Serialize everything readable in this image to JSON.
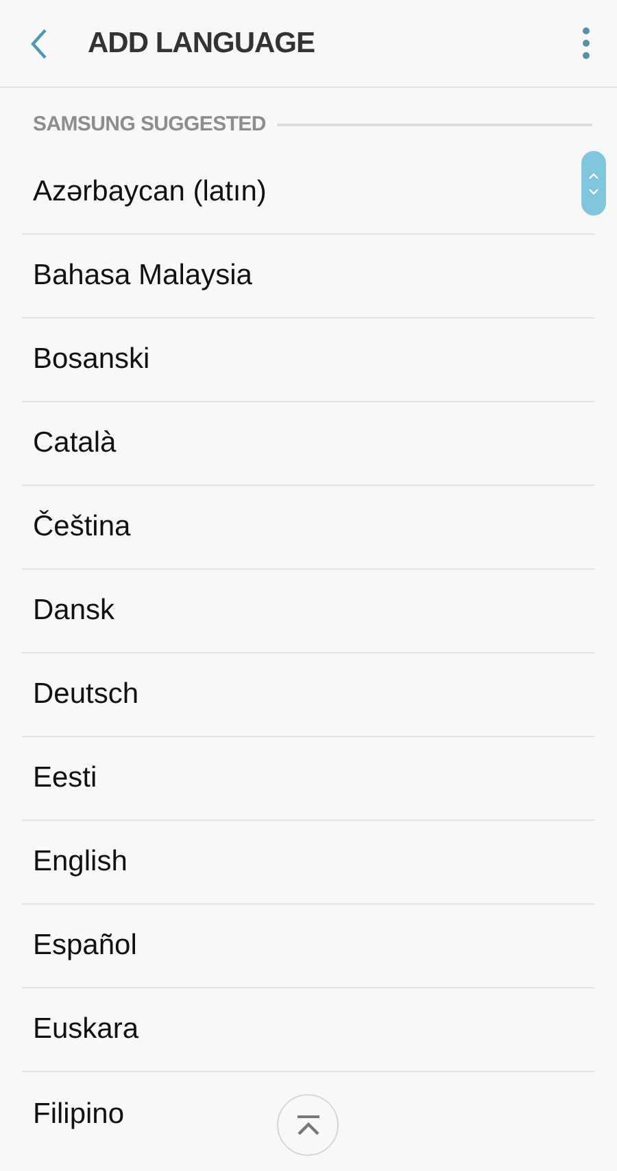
{
  "header": {
    "title": "ADD LANGUAGE"
  },
  "section": {
    "title": "SAMSUNG SUGGESTED"
  },
  "languages": [
    {
      "label": "Azərbaycan (latın)"
    },
    {
      "label": "Bahasa Malaysia"
    },
    {
      "label": "Bosanski"
    },
    {
      "label": "Català"
    },
    {
      "label": "Čeština"
    },
    {
      "label": "Dansk"
    },
    {
      "label": "Deutsch"
    },
    {
      "label": "Eesti"
    },
    {
      "label": "English"
    },
    {
      "label": "Español"
    },
    {
      "label": "Euskara"
    },
    {
      "label": "Filipino"
    }
  ]
}
